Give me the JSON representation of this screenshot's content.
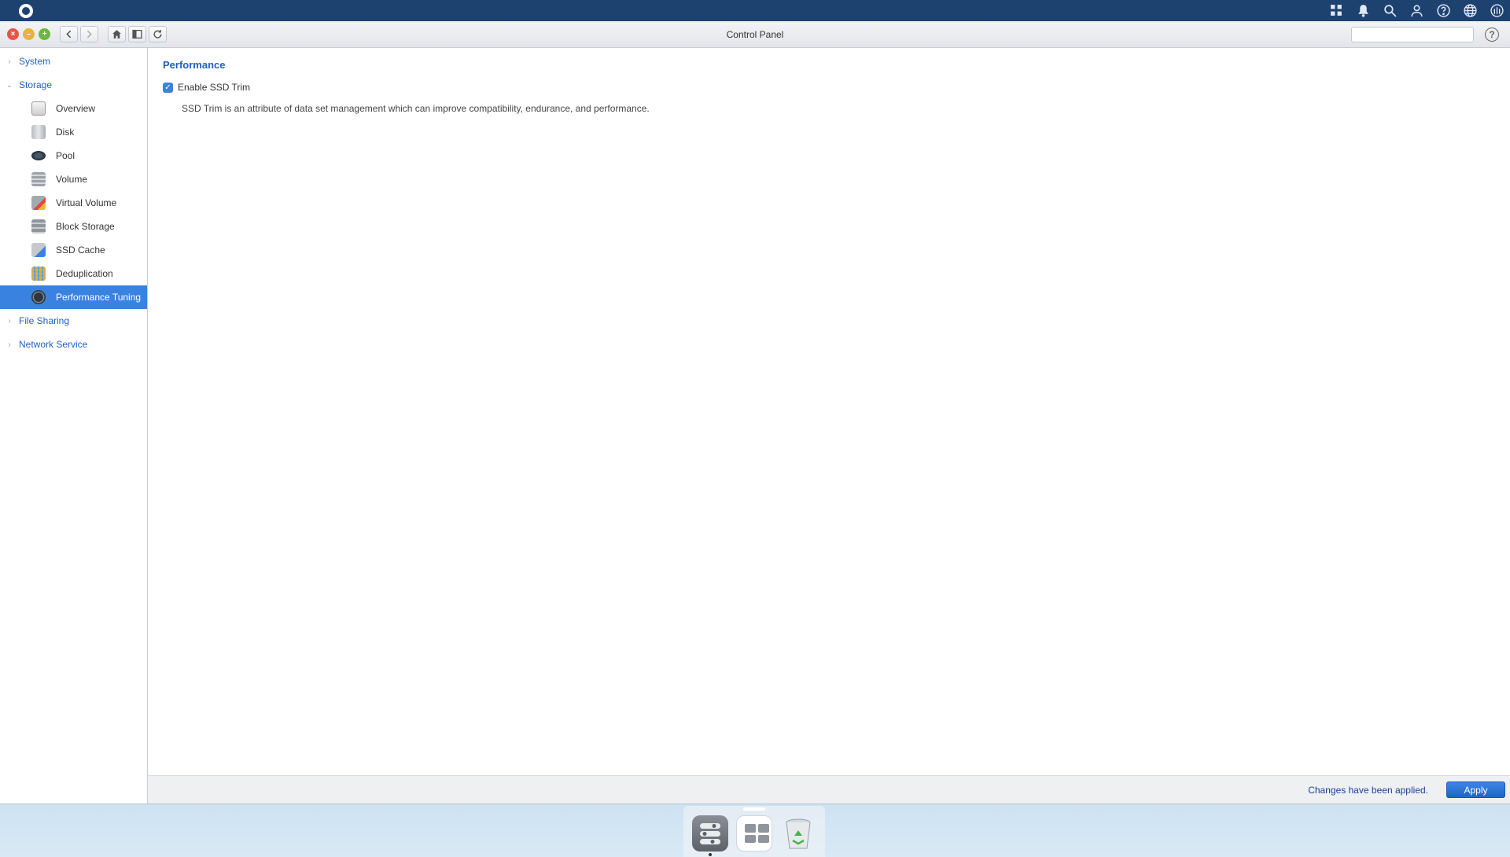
{
  "window": {
    "title": "Control Panel",
    "search_placeholder": "",
    "help_label": "?"
  },
  "sidebar": {
    "categories": [
      {
        "label": "System",
        "expanded": false
      },
      {
        "label": "Storage",
        "expanded": true
      },
      {
        "label": "File Sharing",
        "expanded": false
      },
      {
        "label": "Network Service",
        "expanded": false
      }
    ],
    "storage_items": [
      {
        "label": "Overview",
        "icon": "overview-icon"
      },
      {
        "label": "Disk",
        "icon": "disk-icon"
      },
      {
        "label": "Pool",
        "icon": "pool-icon"
      },
      {
        "label": "Volume",
        "icon": "volume-icon"
      },
      {
        "label": "Virtual Volume",
        "icon": "virtual-volume-icon"
      },
      {
        "label": "Block Storage",
        "icon": "block-storage-icon"
      },
      {
        "label": "SSD Cache",
        "icon": "ssd-cache-icon"
      },
      {
        "label": "Deduplication",
        "icon": "deduplication-icon"
      },
      {
        "label": "Performance Tuning",
        "icon": "performance-tuning-icon",
        "active": true
      }
    ]
  },
  "main": {
    "section_title": "Performance",
    "ssd_trim": {
      "label": "Enable SSD Trim",
      "checked": true,
      "description": "SSD Trim is an attribute of data set management which can improve compatibility, endurance, and performance."
    }
  },
  "footer": {
    "status": "Changes have been applied.",
    "apply_label": "Apply"
  },
  "colors": {
    "accent": "#3a82e0",
    "link_blue": "#2160c4",
    "topbar": "#1e4270"
  }
}
